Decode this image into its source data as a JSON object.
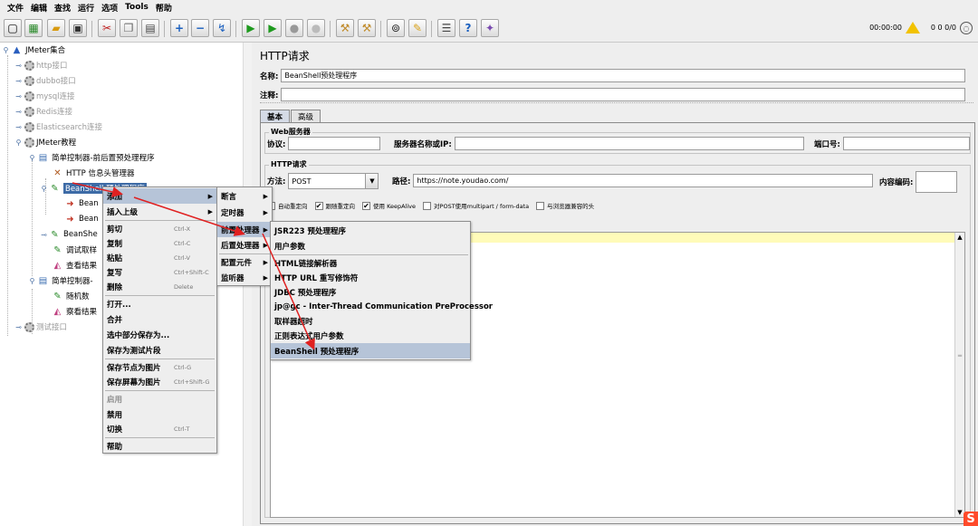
{
  "menubar": [
    "文件",
    "编辑",
    "查找",
    "运行",
    "选项",
    "Tools",
    "帮助"
  ],
  "toolbar": {
    "timer": "00:00:00",
    "warn_count": "0",
    "thread_counts": "0 0/0",
    "icons": [
      "new-icon",
      "templates-icon",
      "open-icon",
      "save-icon",
      "cut-icon",
      "copy-icon",
      "paste-icon",
      "expand-icon",
      "collapse-icon",
      "toggle-icon",
      "start-icon",
      "start-no-pause-icon",
      "stop-icon",
      "shutdown-icon",
      "clear-icon",
      "clear-all-icon",
      "search-icon",
      "reset-search-icon",
      "function-helper-icon",
      "help-icon",
      "remote-icon"
    ]
  },
  "tree": {
    "nodes": [
      {
        "label": "JMeter集合",
        "grey": false
      },
      {
        "label": "http接口",
        "grey": true
      },
      {
        "label": "dubbo接口",
        "grey": true
      },
      {
        "label": "mysql连接",
        "grey": true
      },
      {
        "label": "Redis连接",
        "grey": true
      },
      {
        "label": "Elasticsearch连接",
        "grey": true
      },
      {
        "label": "JMeter教程",
        "grey": false
      },
      {
        "label": "简单控制器-前后置预处理程序",
        "grey": false
      },
      {
        "label": "HTTP 信息头管理器",
        "grey": false
      },
      {
        "label": "BeanShell 预处理程序",
        "grey": false
      },
      {
        "label": "Bean",
        "grey": false
      },
      {
        "label": "Bean",
        "grey": false
      },
      {
        "label": "BeanShe",
        "grey": false
      },
      {
        "label": "调试取样",
        "grey": false
      },
      {
        "label": "查看结果",
        "grey": false
      },
      {
        "label": "简单控制器-",
        "grey": false
      },
      {
        "label": "随机数",
        "grey": false
      },
      {
        "label": "察看结果",
        "grey": false
      },
      {
        "label": "测试接口",
        "grey": true
      }
    ]
  },
  "panel": {
    "title": "HTTP请求",
    "name_label": "名称:",
    "name_value": "BeanShell预处理程序",
    "comment_label": "注释:",
    "comment_value": "",
    "tabs": [
      "基本",
      "高级"
    ],
    "web_server_group": "Web服务器",
    "protocol_label": "协议:",
    "server_label": "服务器名称或IP:",
    "port_label": "端口号:",
    "http_group": "HTTP请求",
    "method_label": "方法:",
    "method_value": "POST",
    "path_label": "路径:",
    "path_value": "https://note.youdao.com/",
    "encoding_label": "内容编码:",
    "checkboxes": [
      {
        "label": "自动重定向",
        "checked": false
      },
      {
        "label": "跟随重定向",
        "checked": true
      },
      {
        "label": "使用 KeepAlive",
        "checked": true
      },
      {
        "label": "对POST使用multipart / form-data",
        "checked": false
      },
      {
        "label": "与浏览器兼容的头",
        "checked": false
      }
    ]
  },
  "context_menu": {
    "items": [
      {
        "label": "添加",
        "accel": "",
        "sub": true,
        "disabled": false,
        "hl": true
      },
      {
        "label": "插入上级",
        "accel": "",
        "sub": true,
        "disabled": false
      },
      {
        "label": "剪切",
        "accel": "Ctrl-X",
        "sub": false,
        "disabled": false
      },
      {
        "label": "复制",
        "accel": "Ctrl-C",
        "sub": false,
        "disabled": false
      },
      {
        "label": "粘贴",
        "accel": "Ctrl-V",
        "sub": false,
        "disabled": false
      },
      {
        "label": "复写",
        "accel": "Ctrl+Shift-C",
        "sub": false,
        "disabled": false
      },
      {
        "label": "删除",
        "accel": "Delete",
        "sub": false,
        "disabled": false
      },
      {
        "label": "打开...",
        "accel": "",
        "sub": false,
        "disabled": false
      },
      {
        "label": "合并",
        "accel": "",
        "sub": false,
        "disabled": false
      },
      {
        "label": "选中部分保存为...",
        "accel": "",
        "sub": false,
        "disabled": false
      },
      {
        "label": "保存为测试片段",
        "accel": "",
        "sub": false,
        "disabled": false
      },
      {
        "label": "保存节点为图片",
        "accel": "Ctrl-G",
        "sub": false,
        "disabled": false
      },
      {
        "label": "保存屏幕为图片",
        "accel": "Ctrl+Shift-G",
        "sub": false,
        "disabled": false
      },
      {
        "label": "启用",
        "accel": "",
        "sub": false,
        "disabled": true
      },
      {
        "label": "禁用",
        "accel": "",
        "sub": false,
        "disabled": false
      },
      {
        "label": "切换",
        "accel": "Ctrl-T",
        "sub": false,
        "disabled": false
      },
      {
        "label": "帮助",
        "accel": "",
        "sub": false,
        "disabled": false
      }
    ]
  },
  "add_menu": {
    "items": [
      "断言",
      "定时器",
      "前置处理器",
      "后置处理器",
      "配置元件",
      "监听器"
    ]
  },
  "pre_menu": {
    "items": [
      "JSR223 预处理程序",
      "用户参数",
      "HTML链接解析器",
      "HTTP URL 重写修饰符",
      "JDBC 预处理程序",
      "jp@gc - Inter-Thread Communication PreProcessor",
      "取样器超时",
      "正则表达式用户参数",
      "BeanShell 预处理程序"
    ]
  },
  "colors": {
    "arrow": "#e02020",
    "selection": "#3d6ba6",
    "menu_highlight": "#b6c4d8"
  }
}
